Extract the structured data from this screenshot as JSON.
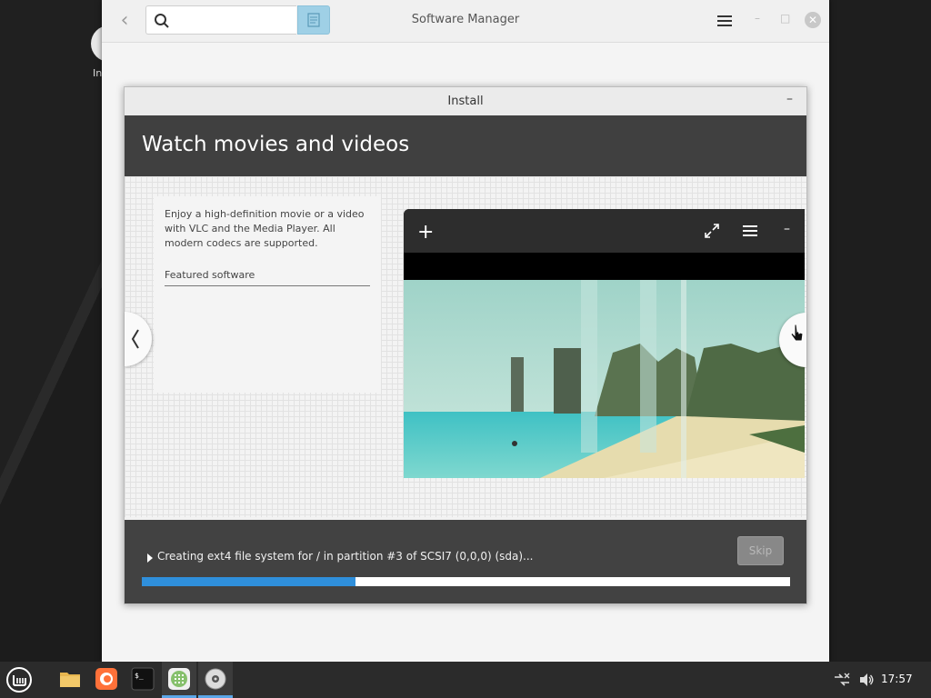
{
  "software_manager": {
    "title": "Software Manager",
    "search": {
      "value": "",
      "placeholder": ""
    }
  },
  "install_dialog": {
    "title": "Install",
    "minimize_label": "–",
    "slide": {
      "heading": "Watch movies and videos",
      "description": "Enjoy a high-definition movie or a video with VLC and the Media Player. All modern codecs are supported.",
      "featured_label": "Featured software"
    },
    "player": {
      "add_label": "+",
      "minimize_label": "–"
    },
    "progress": {
      "status": "Creating ext4 file system for / in partition #3 of SCSI7 (0,0,0) (sda)...",
      "fraction": 0.33,
      "skip_label": "Skip"
    }
  },
  "taskbar": {
    "clock": "17:57",
    "apps": [
      "menu-icon",
      "files-icon",
      "firefox-icon",
      "terminal-icon",
      "software-manager-icon",
      "installer-icon"
    ]
  },
  "colors": {
    "accent": "#2f8fdb",
    "banner": "#404040",
    "search_button": "#9fd0e6"
  }
}
